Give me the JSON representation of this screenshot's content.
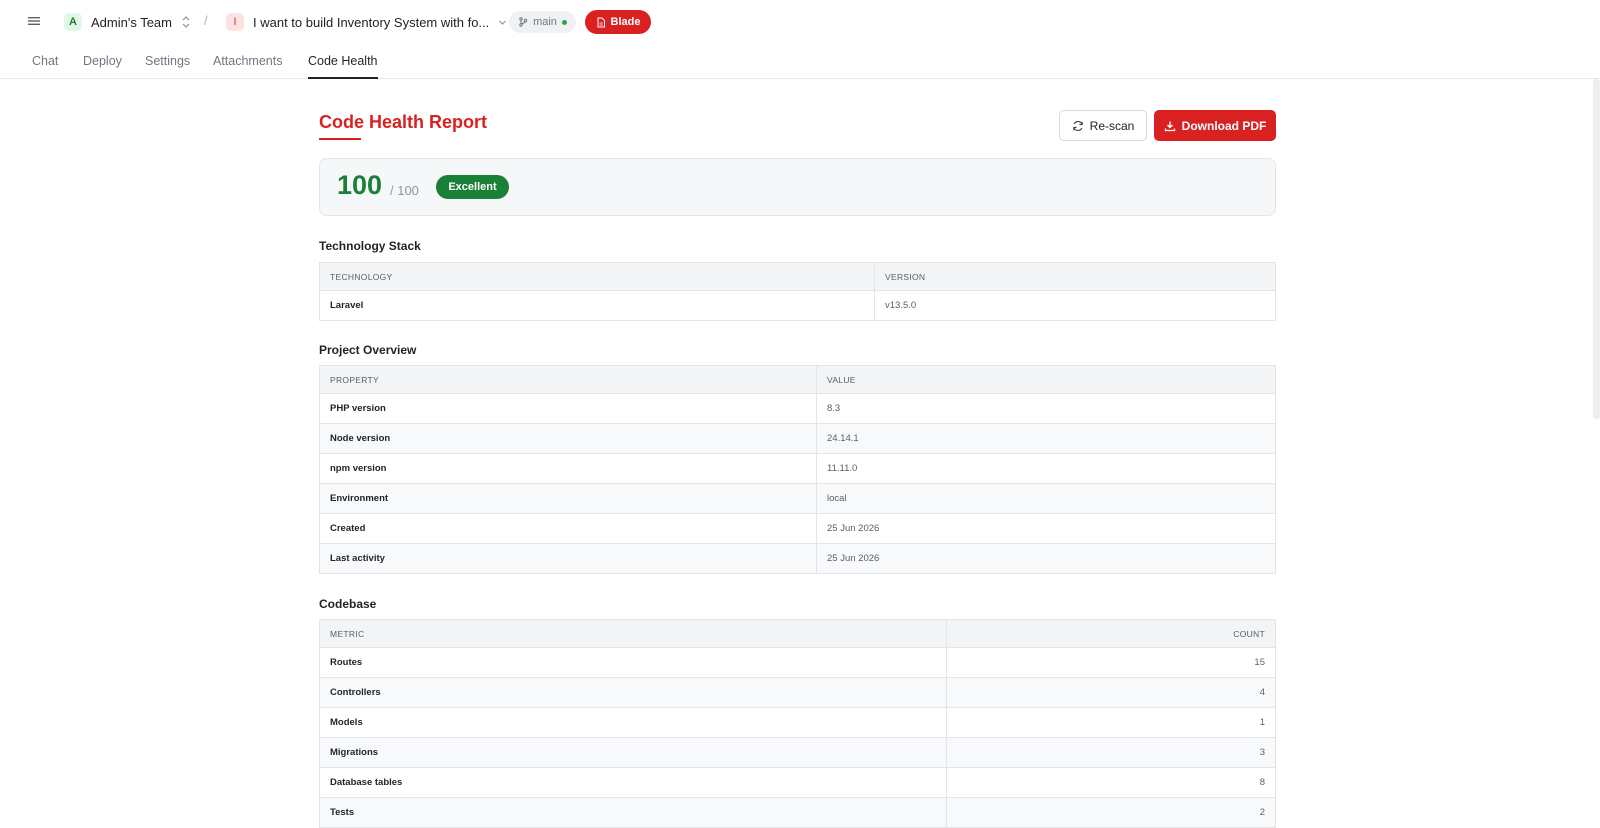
{
  "header": {
    "team_initial": "A",
    "team_name": "Admin's Team",
    "separator": "/",
    "project_initial": "I",
    "project_name": "I want to build Inventory System with fo...",
    "branch": "main",
    "stack_badge": "Blade"
  },
  "tabs": [
    "Chat",
    "Deploy",
    "Settings",
    "Attachments",
    "Code Health"
  ],
  "active_tab": "Code Health",
  "report": {
    "title": "Code Health Report",
    "rescan_label": "Re-scan",
    "download_label": "Download PDF",
    "score": "100",
    "score_max": "/ 100",
    "grade": "Excellent"
  },
  "tech_stack": {
    "title": "Technology Stack",
    "headers": [
      "TECHNOLOGY",
      "VERSION"
    ],
    "rows": [
      [
        "Laravel",
        "v13.5.0"
      ]
    ]
  },
  "overview": {
    "title": "Project Overview",
    "headers": [
      "PROPERTY",
      "VALUE"
    ],
    "rows": [
      [
        "PHP version",
        "8.3"
      ],
      [
        "Node version",
        "24.14.1"
      ],
      [
        "npm version",
        "11.11.0"
      ],
      [
        "Environment",
        "local"
      ],
      [
        "Created",
        "25 Jun 2026"
      ],
      [
        "Last activity",
        "25 Jun 2026"
      ]
    ]
  },
  "codebase": {
    "title": "Codebase",
    "headers": [
      "METRIC",
      "COUNT"
    ],
    "rows": [
      [
        "Routes",
        "15"
      ],
      [
        "Controllers",
        "4"
      ],
      [
        "Models",
        "1"
      ],
      [
        "Migrations",
        "3"
      ],
      [
        "Database tables",
        "8"
      ],
      [
        "Tests",
        "2"
      ]
    ]
  },
  "colors": {
    "accent": "#d92121",
    "success": "#1a7f37"
  }
}
